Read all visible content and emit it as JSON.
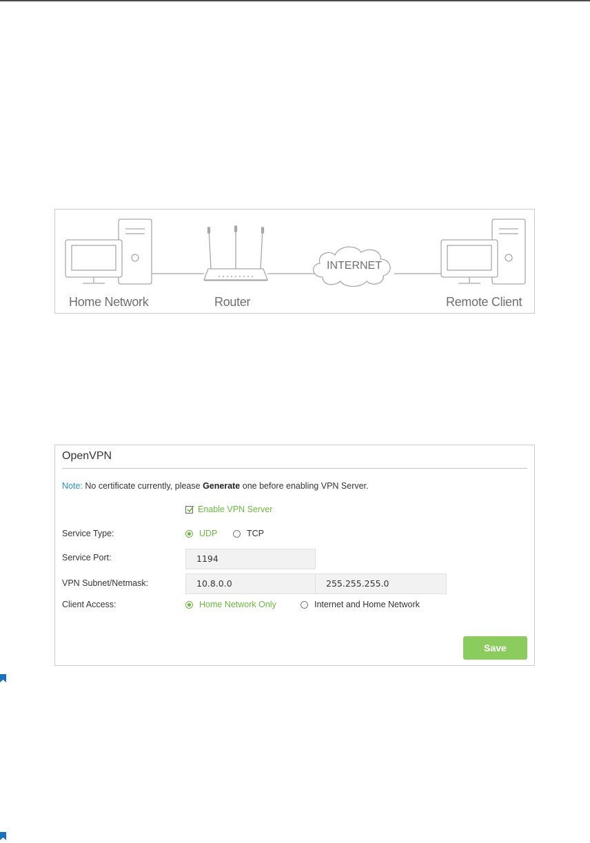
{
  "diagram": {
    "labels": {
      "home_network": "Home Network",
      "router": "Router",
      "internet": "INTERNET",
      "remote_client": "Remote Client"
    }
  },
  "openvpn": {
    "title": "OpenVPN",
    "note": {
      "label": "Note:",
      "text_before": "No certificate currently, please",
      "bold": "Generate",
      "text_after": "one before enabling VPN Server."
    },
    "enable_vpn_server": {
      "label": "Enable VPN Server",
      "checked": true
    },
    "service_type": {
      "label": "Service Type:",
      "options": [
        "UDP",
        "TCP"
      ],
      "selected": "UDP"
    },
    "service_port": {
      "label": "Service Port:",
      "value": "1194"
    },
    "vpn_subnet": {
      "label": "VPN Subnet/Netmask:",
      "subnet": "10.8.0.0",
      "netmask": "255.255.255.0"
    },
    "client_access": {
      "label": "Client Access:",
      "options": [
        "Home Network Only",
        "Internet and Home Network"
      ],
      "selected": "Home Network Only"
    },
    "save_label": "Save"
  },
  "colors": {
    "accent_green": "#6bb73d",
    "save_button": "#8ccc5f",
    "note_blue": "#2b8fc9",
    "bookmark_blue": "#1a6fbf"
  },
  "icons": [
    "bookmark-icon",
    "checkbox-icon",
    "radio-icon",
    "computer-icon",
    "router-icon",
    "cloud-icon"
  ]
}
